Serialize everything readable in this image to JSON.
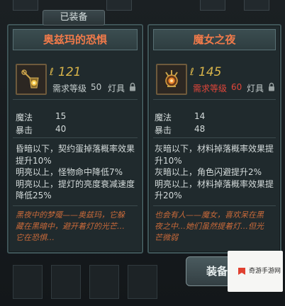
{
  "header": {
    "equipped_label": "已装备"
  },
  "cards": [
    {
      "title": "奥兹玛的恐惧",
      "lamp_value": "121",
      "req_label": "需求等级",
      "req_level": "50",
      "req_met": true,
      "slot": "灯具",
      "stats": [
        {
          "name": "魔法",
          "value": "15"
        },
        {
          "name": "暴击",
          "value": "40"
        }
      ],
      "effects": [
        "昏暗以下，契约蛋掉落概率效果",
        "提升10%",
        "明亮以上，怪物命中降低7%",
        "明亮以上，提灯的亮度衰减速度",
        "降低25%"
      ],
      "flavor": [
        "黑夜中的梦魇——奥兹玛，它躲",
        "藏在黑暗中，避开着灯的光芒…",
        "它在恐惧…"
      ]
    },
    {
      "title": "魔女之夜",
      "lamp_value": "145",
      "req_label": "需求等级",
      "req_level": "60",
      "req_met": false,
      "slot": "灯具",
      "stats": [
        {
          "name": "魔法",
          "value": "14"
        },
        {
          "name": "暴击",
          "value": "48"
        }
      ],
      "effects": [
        "灰暗以下，材料掉落概率效果提",
        "升10%",
        "灰暗以上，角色闪避提升2%",
        "明亮以上，材料掉落概率效果提",
        "升20%"
      ],
      "flavor": [
        "也会有人——魔女，喜欢呆在黑",
        "夜之中…她们虽然提着灯…但光",
        "芒微弱"
      ]
    }
  ],
  "actions": {
    "equip_label": "装备"
  },
  "watermark": {
    "text": "奇游手游网"
  },
  "colors": {
    "title": "#f07a4a",
    "lamp": "#d8b44a",
    "req_unmet": "#e0463a",
    "flavor": "#c96a3a"
  }
}
